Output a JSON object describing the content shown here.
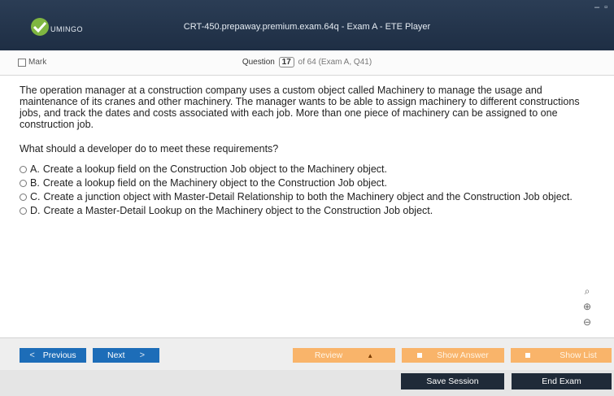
{
  "window": {
    "logo_text": "UMINGO",
    "title": "CRT-450.prepaway.premium.exam.64q - Exam A - ETE Player",
    "minimize": "–",
    "restore": "▫"
  },
  "question_bar": {
    "mark_label": "Mark",
    "question_label": "Question",
    "question_number": "17",
    "question_of": "of 64 (Exam A, Q41)"
  },
  "question": {
    "text": "The operation manager at a construction company uses a custom object called Machinery to manage the usage and maintenance of its cranes and other machinery. The manager wants to be able to assign machinery to different constructions jobs, and track the dates and costs associated with each job. More than one piece of machinery can be assigned to one construction job.",
    "prompt": "What should a developer do to meet these requirements?",
    "options": [
      {
        "letter": "A.",
        "text": "Create a lookup field on the Construction Job object to the Machinery object."
      },
      {
        "letter": "B.",
        "text": "Create a lookup field on the Machinery object to the Construction Job object."
      },
      {
        "letter": "C.",
        "text": "Create a junction object with Master-Detail Relationship to both the Machinery object and the Construction Job object."
      },
      {
        "letter": "D.",
        "text": "Create a Master-Detail Lookup on the Machinery object to the Construction Job object."
      }
    ]
  },
  "zoom": {
    "search_icon": "⌕",
    "zoom_in_icon": "⊕",
    "zoom_out_icon": "⊖"
  },
  "nav": {
    "previous_label": "Previous",
    "next_label": "Next",
    "review_label": "Review",
    "show_answer_label": "Show Answer",
    "show_list_label": "Show List",
    "save_session_label": "Save Session",
    "end_exam_label": "End Exam"
  },
  "colors": {
    "title_bar": "#22344c",
    "nav_blue": "#1d6db8",
    "nav_orange": "#f9b46a",
    "dark_button": "#1f2a38",
    "logo_green": "#7fb641"
  }
}
